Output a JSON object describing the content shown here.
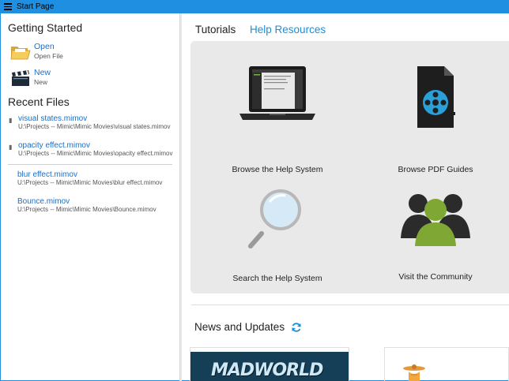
{
  "window": {
    "title": "Start Page"
  },
  "getting_started": {
    "title": "Getting Started",
    "items": [
      {
        "label": "Open",
        "sub": "Open File",
        "icon": "folder-icon"
      },
      {
        "label": "New",
        "sub": "New",
        "icon": "clapperboard-icon"
      }
    ]
  },
  "recent_files": {
    "title": "Recent Files",
    "pinned": [
      {
        "name": "visual states.mimov",
        "path": "U:\\Projects -- Mimic\\Mimic Movies\\visual states.mimov"
      },
      {
        "name": "opacity effect.mimov",
        "path": "U:\\Projects -- Mimic\\Mimic Movies\\opacity effect.mimov"
      }
    ],
    "items": [
      {
        "name": "blur effect.mimov",
        "path": "U:\\Projects -- Mimic\\Mimic Movies\\blur effect.mimov"
      },
      {
        "name": "Bounce.mimov",
        "path": "U:\\Projects -- Mimic\\Mimic Movies\\Bounce.mimov"
      }
    ]
  },
  "tabs": [
    {
      "label": "Tutorials",
      "active": false
    },
    {
      "label": "Help Resources",
      "active": true
    }
  ],
  "help_tiles": [
    {
      "label": "Browse the Help System",
      "icon": "laptop-icon"
    },
    {
      "label": "Browse PDF Guides",
      "icon": "pdf-film-icon"
    },
    {
      "label": "Search the Help System",
      "icon": "magnifier-icon"
    },
    {
      "label": "Visit the Community",
      "icon": "community-icon"
    }
  ],
  "news": {
    "title": "News and Updates",
    "refresh_icon": "refresh-icon"
  },
  "news_cards": [
    {
      "logo_text": "MADWORLD"
    },
    {
      "icon": "propeller-icon"
    }
  ],
  "colors": {
    "accent": "#1e8fe1",
    "link": "#1a6fc9",
    "panel_bg": "#e9e9e9"
  }
}
